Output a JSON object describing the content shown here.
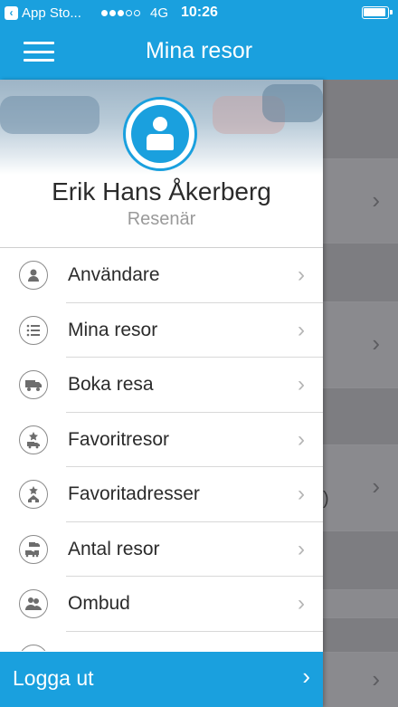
{
  "status_bar": {
    "back_app_label": "App Sto...",
    "network": "4G",
    "time": "10:26",
    "signal_bars": 3,
    "signal_total": 5
  },
  "nav": {
    "title": "Mina resor",
    "menu_icon": "hamburger-menu-icon"
  },
  "profile": {
    "name": "Erik Hans Åkerberg",
    "role": "Resenär",
    "avatar_icon": "person-icon"
  },
  "menu": {
    "items": [
      {
        "label": "Användare",
        "icon": "user-icon"
      },
      {
        "label": "Mina resor",
        "icon": "list-icon"
      },
      {
        "label": "Boka resa",
        "icon": "truck-icon"
      },
      {
        "label": "Favoritresor",
        "icon": "star-truck-icon"
      },
      {
        "label": "Favoritadresser",
        "icon": "star-home-icon"
      },
      {
        "label": "Antal resor",
        "icon": "multiple-trucks-icon"
      },
      {
        "label": "Ombud",
        "icon": "group-icon"
      }
    ]
  },
  "logout": {
    "label": "Logga ut"
  },
  "background": {
    "peek_text": ")"
  },
  "colors": {
    "accent": "#1aa0de",
    "text": "#2b2b2b",
    "secondary_text": "#9a9a9a"
  }
}
